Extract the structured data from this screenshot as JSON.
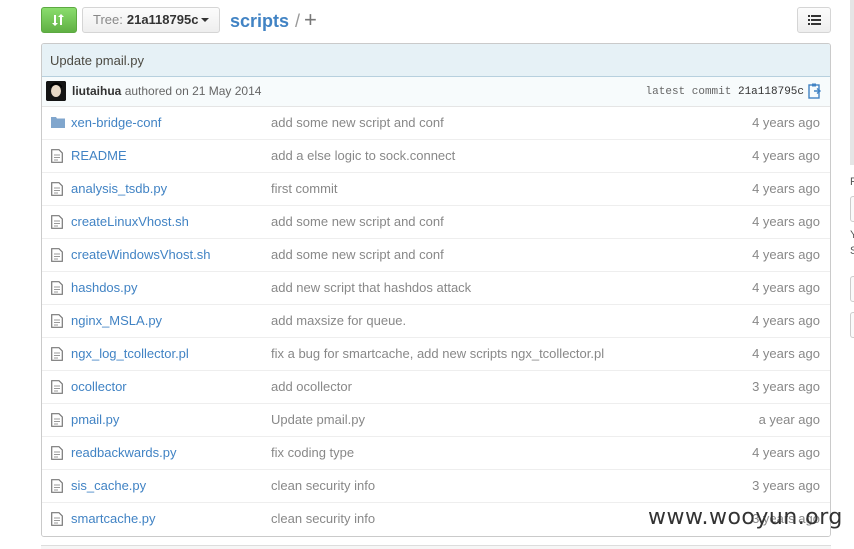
{
  "toolbar": {
    "compare_icon": "compare-refresh-icon",
    "tree_label": "Tree:",
    "tree_value": "21a118795c",
    "list_icon": "list-icon"
  },
  "breadcrumb": {
    "current": "scripts",
    "separator": "/",
    "add": "+"
  },
  "commit": {
    "title": "Update pmail.py",
    "author": "liutaihua",
    "authored_text": "authored on 21 May 2014",
    "latest_label": "latest commit",
    "sha": "21a118795c",
    "clipboard_icon": "clipboard-icon"
  },
  "files": [
    {
      "type": "directory",
      "icon": "folder-icon",
      "name": "xen-bridge-conf",
      "message": "add some new script and conf",
      "age": "4 years ago"
    },
    {
      "type": "file",
      "icon": "file-icon",
      "name": "README",
      "message": "add a else logic to sock.connect",
      "age": "4 years ago"
    },
    {
      "type": "file",
      "icon": "file-icon",
      "name": "analysis_tsdb.py",
      "message": "first commit",
      "age": "4 years ago"
    },
    {
      "type": "file",
      "icon": "file-icon",
      "name": "createLinuxVhost.sh",
      "message": "add some new script and conf",
      "age": "4 years ago"
    },
    {
      "type": "file",
      "icon": "file-icon",
      "name": "createWindowsVhost.sh",
      "message": "add some new script and conf",
      "age": "4 years ago"
    },
    {
      "type": "file",
      "icon": "file-icon",
      "name": "hashdos.py",
      "message": "add new script that hashdos attack",
      "age": "4 years ago"
    },
    {
      "type": "file",
      "icon": "file-icon",
      "name": "nginx_MSLA.py",
      "message": "add maxsize for queue.",
      "age": "4 years ago"
    },
    {
      "type": "file",
      "icon": "file-icon",
      "name": "ngx_log_tcollector.pl",
      "message": "fix a bug for smartcache, add new scripts ngx_tcollector.pl",
      "age": "4 years ago"
    },
    {
      "type": "file",
      "icon": "file-icon",
      "name": "ocollector",
      "message": "add ocollector",
      "age": "3 years ago"
    },
    {
      "type": "file",
      "icon": "file-icon",
      "name": "pmail.py",
      "message": "Update pmail.py",
      "age": "a year ago"
    },
    {
      "type": "file",
      "icon": "file-icon",
      "name": "readbackwards.py",
      "message": "fix coding type",
      "age": "4 years ago"
    },
    {
      "type": "file",
      "icon": "file-icon",
      "name": "sis_cache.py",
      "message": "clean security info",
      "age": "3 years ago"
    },
    {
      "type": "file",
      "icon": "file-icon",
      "name": "smartcache.py",
      "message": "clean security info",
      "age": "3 years ago"
    }
  ],
  "sidebar_fragments": [
    "F",
    "Y",
    "S"
  ],
  "watermark": "www.wooyun.org",
  "colors": {
    "link": "#4183c4",
    "muted": "#888888",
    "commit_bg": "#e6f1f6",
    "compare_button": "#6cc644"
  }
}
